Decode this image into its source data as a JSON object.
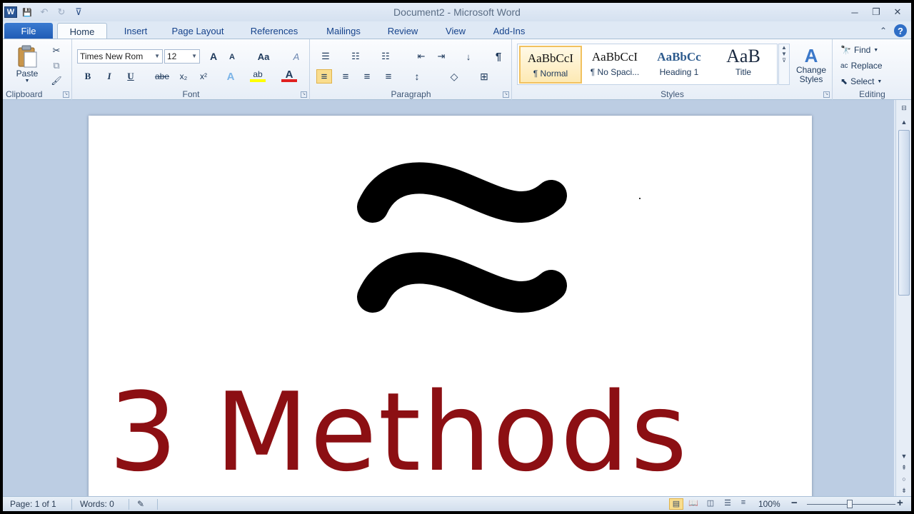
{
  "window": {
    "title": "Document2  -  Microsoft Word",
    "app_icon_letter": "W",
    "controls": {
      "minimize": "─",
      "restore": "❐",
      "close": "✕"
    }
  },
  "quick_access": {
    "save": "💾",
    "undo": "↶",
    "redo": "↻",
    "customize": "⊽"
  },
  "tabs": [
    "File",
    "Home",
    "Insert",
    "Page Layout",
    "References",
    "Mailings",
    "Review",
    "View",
    "Add-Ins"
  ],
  "help": {
    "collapse": "⌃",
    "help": "?"
  },
  "ribbon": {
    "clipboard": {
      "label": "Clipboard",
      "paste": "Paste",
      "cut": "✂",
      "copy": "⧉",
      "format_painter": "🖌"
    },
    "font": {
      "label": "Font",
      "font_name": "Times New Rom",
      "font_size": "12",
      "grow": "A",
      "shrink": "A",
      "change_case": "Aa",
      "clear_format": "A",
      "bold": "B",
      "italic": "I",
      "underline": "U",
      "strike": "abe",
      "subscript": "x₂",
      "superscript": "x²",
      "text_effects": "A",
      "highlight": "ab",
      "font_color": "A"
    },
    "paragraph": {
      "label": "Paragraph",
      "bullets": "☰",
      "numbering": "☷",
      "multilevel": "☷",
      "decrease_indent": "⇤",
      "increase_indent": "⇥",
      "sort": "↓",
      "show_marks": "¶",
      "align_left": "≡",
      "center": "≡",
      "align_right": "≡",
      "justify": "≡",
      "line_spacing": "↕",
      "shading": "◇",
      "borders": "⊞"
    },
    "styles": {
      "label": "Styles",
      "items": [
        {
          "preview": "AaBbCcI",
          "name": "¶ Normal"
        },
        {
          "preview": "AaBbCcI",
          "name": "¶ No Spaci..."
        },
        {
          "preview": "AaBbCc",
          "name": "Heading 1"
        },
        {
          "preview": "AaB",
          "name": "Title"
        }
      ],
      "change_styles_line1": "Change",
      "change_styles_line2": "Styles"
    },
    "editing": {
      "label": "Editing",
      "find": "Find",
      "replace": "Replace",
      "select": "Select"
    }
  },
  "document": {
    "symbol": "≈",
    "text": "3 Methods",
    "text_color": "#8c0f13"
  },
  "status": {
    "page": "Page: 1 of 1",
    "words": "Words: 0",
    "zoom": "100%",
    "zoom_out": "−",
    "zoom_in": "+"
  }
}
